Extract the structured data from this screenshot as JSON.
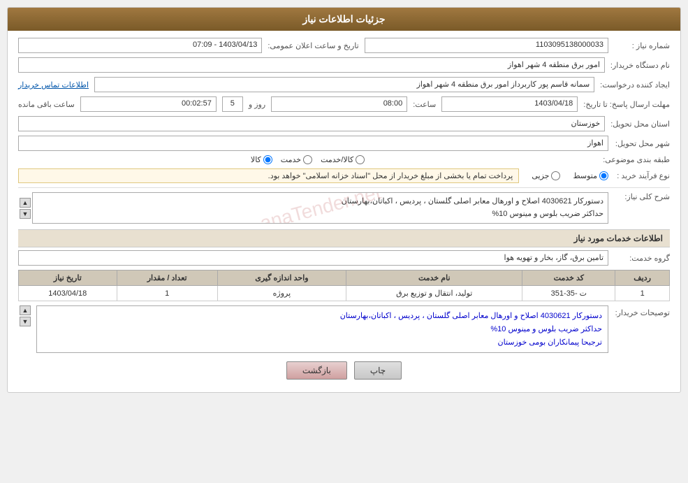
{
  "header": {
    "title": "جزئیات اطلاعات نیاز"
  },
  "fields": {
    "need_number_label": "شماره نیاز :",
    "need_number_value": "1103095138000033",
    "date_label": "تاریخ و ساعت اعلان عمومی:",
    "date_value": "1403/04/13 - 07:09",
    "buyer_org_label": "نام دستگاه خریدار:",
    "buyer_org_value": "امور برق منطقه 4 شهر اهواز",
    "creator_label": "ایجاد کننده درخواست:",
    "creator_value": "سمانه قاسم پور کاربرداز امور برق منطقه 4 شهر اهواز",
    "contact_link": "اطلاعات تماس خریدار",
    "send_date_label": "مهلت ارسال پاسخ: تا تاریخ:",
    "send_date_value": "1403/04/18",
    "send_time_label": "ساعت:",
    "send_time_value": "08:00",
    "send_day_label": "روز و",
    "send_day_value": "5",
    "remaining_label": "ساعت باقی مانده",
    "remaining_value": "00:02:57",
    "province_label": "استان محل تحویل:",
    "province_value": "خوزستان",
    "city_label": "شهر محل تحویل:",
    "city_value": "اهواز",
    "category_label": "طبقه بندی موضوعی:",
    "radio_goods": "کالا",
    "radio_service": "خدمت",
    "radio_goods_service": "کالا/خدمت",
    "process_label": "نوع فرآیند خرید :",
    "radio_piece": "جزیی",
    "radio_medium": "متوسط",
    "process_note": "پرداخت تمام یا بخشی از مبلغ خریدار از محل \"اسناد خزانه اسلامی\" خواهد بود.",
    "need_desc_label": "شرح کلی نیاز:",
    "need_desc_value": "دستورکار 4030621 اصلاح و اورهال معابر اصلی گلستان ، پردیس ، اکباتان،بهارستان\nحداکثر ضریب بلوس و مینوس 10%",
    "services_info_label": "اطلاعات خدمات مورد نیاز",
    "service_group_label": "گروه خدمت:",
    "service_group_value": "تامین برق، گاز، بخار و تهویه هوا",
    "table": {
      "headers": [
        "ردیف",
        "کد خدمت",
        "نام خدمت",
        "واحد اندازه گیری",
        "تعداد / مقدار",
        "تاریخ نیاز"
      ],
      "rows": [
        {
          "row": "1",
          "code": "ت -35-351",
          "name": "تولید، انتقال و توزیع برق",
          "unit": "پروژه",
          "count": "1",
          "date": "1403/04/18"
        }
      ]
    },
    "buyer_notes_label": "توصیحات خریدار:",
    "buyer_notes_value": "دستورکار 4030621 اصلاح و اورهال معابر اصلی گلستان ، پردیس ، اکباتان،بهارستان\nحداکثر ضریب بلوس و مینوس 10%\nترجیحا پیمانکاران بومی خوزستان"
  },
  "buttons": {
    "print": "چاپ",
    "back": "بازگشت"
  },
  "watermark": "anaTender.net"
}
